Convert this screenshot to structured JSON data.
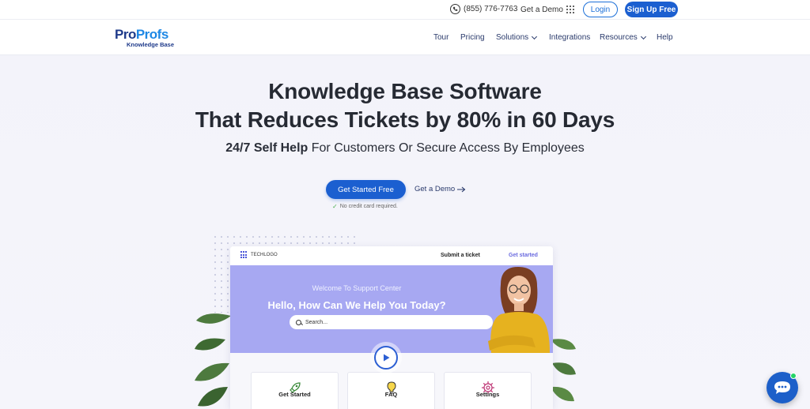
{
  "topbar": {
    "phone": "(855) 776-7763",
    "demo": "Get a Demo",
    "login": "Login",
    "signup": "Sign Up Free"
  },
  "nav": {
    "logo_brand_1": "Pro",
    "logo_brand_2": "Profs",
    "logo_sub": "Knowledge Base",
    "items": [
      {
        "label": "Tour"
      },
      {
        "label": "Pricing"
      },
      {
        "label": "Solutions"
      },
      {
        "label": "Integrations"
      },
      {
        "label": "Resources"
      },
      {
        "label": "Help"
      }
    ]
  },
  "hero": {
    "title_line1": "Knowledge Base Software",
    "title_line2": "That Reduces Tickets by 80% in 60 Days",
    "subtitle_bold": "24/7 Self Help",
    "subtitle_rest": " For Customers Or Secure Access By Employees",
    "cta_primary": "Get Started Free",
    "cta_secondary": "Get a Demo",
    "no_cc": "No credit card required."
  },
  "preview": {
    "logo_text": "TECHLOGO",
    "submit_ticket": "Submit a ticket",
    "get_started": "Get started",
    "welcome": "Welcome To Support Center",
    "hello": "Hello, How Can We Help You Today?",
    "search_placeholder": "Search...",
    "tiles": [
      {
        "label": "Get Started",
        "icon": "rocket-icon"
      },
      {
        "label": "FAQ",
        "icon": "lightbulb-icon"
      },
      {
        "label": "Settings",
        "icon": "gear-icon"
      }
    ]
  },
  "colors": {
    "brand_blue": "#1b5fd0",
    "banner_purple": "#a7a8f2",
    "hero_bg": "#f3f3fa"
  }
}
